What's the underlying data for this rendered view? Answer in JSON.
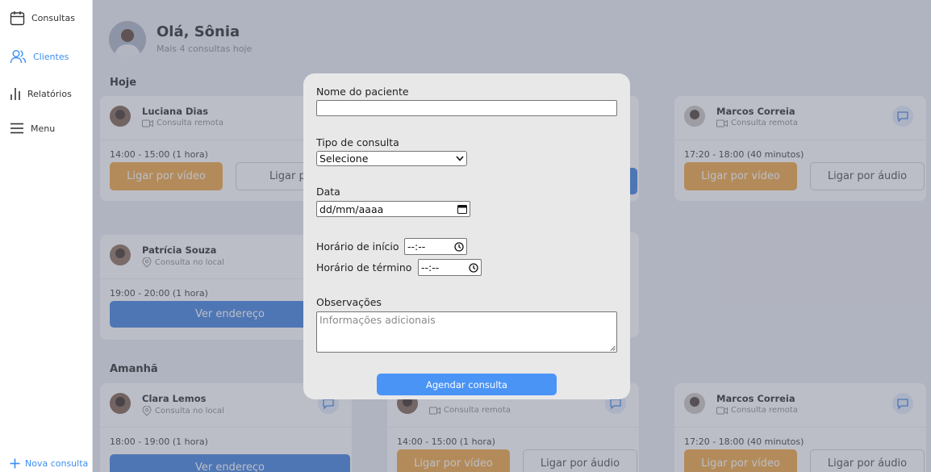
{
  "sidebar": {
    "items": [
      {
        "label": "Consultas",
        "icon": "calendar-icon"
      },
      {
        "label": "Clientes",
        "icon": "users-icon"
      },
      {
        "label": "Relatórios",
        "icon": "bar-chart-icon"
      },
      {
        "label": "Menu",
        "icon": "menu-icon"
      }
    ],
    "new_label": "Nova consulta"
  },
  "header": {
    "greeting": "Olá, Sônia",
    "subtitle": "Mais 4 consultas hoje"
  },
  "sections": {
    "today": "Hoje",
    "tomorrow": "Amanhã"
  },
  "cards": [
    {
      "name": "Luciana Dias",
      "type": "Consulta remota",
      "time": "14:00 - 15:00 (1 hora)",
      "video": "Ligar por vídeo",
      "audio": "Ligar por"
    },
    {
      "name": "Marcos Correia",
      "type": "Consulta remota",
      "time": "17:20 - 18:00 (40 minutos)",
      "video": "Ligar por vídeo",
      "audio": "Ligar por áudio"
    },
    {
      "name": "Patrícia Souza",
      "type": "Consulta no local",
      "time": "19:00 - 20:00 (1 hora)",
      "address": "Ver endereço"
    },
    {
      "name": "Clara Lemos",
      "type": "Consulta no local",
      "time": "18:00 - 19:00 (1 hora)",
      "address": "Ver endereço"
    },
    {
      "name": "",
      "type": "Consulta remota",
      "time": "14:00 - 15:00 (1 hora)",
      "video": "Ligar por vídeo",
      "audio": "Ligar por áudio"
    },
    {
      "name": "Marcos Correia",
      "type": "Consulta remota",
      "time": "17:20 - 18:00 (40 minutos)",
      "video": "Ligar por vídeo",
      "audio": "Ligar por áudio"
    }
  ],
  "modal": {
    "patient_label": "Nome do paciente",
    "patient_value": "",
    "type_label": "Tipo de consulta",
    "type_value": "Selecione",
    "date_label": "Data",
    "date_placeholder": "dd/mm/aaaa",
    "start_label": "Horário de início",
    "end_label": "Horário de término",
    "time_placeholder": "--:--",
    "notes_label": "Observações",
    "notes_placeholder": "Informações adicionais",
    "submit_label": "Agendar consulta"
  },
  "colors": {
    "accent_blue": "#3b8ef3",
    "video_orange": "#f0a33a",
    "address_blue": "#3b7ddd",
    "submit_blue": "#4a94f6"
  }
}
